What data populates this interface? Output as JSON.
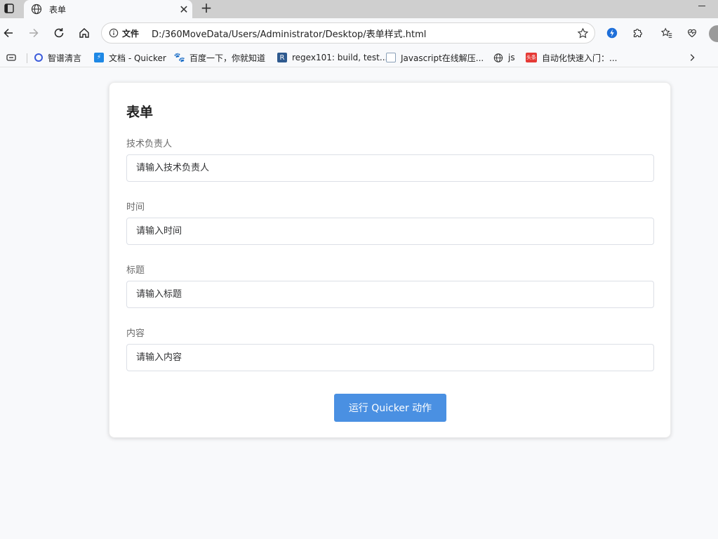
{
  "browser": {
    "tab": {
      "title": "表单"
    },
    "address": {
      "scheme": "文件",
      "url": "D:/360MoveData/Users/Administrator/Desktop/表单样式.html"
    },
    "bookmarks": [
      {
        "label": "智谱清言",
        "icon": "zhipu-icon",
        "color": "#3b5bdb"
      },
      {
        "label": "文档 - Quicker",
        "icon": "quicker-icon",
        "color": "#1e88e5"
      },
      {
        "label": "百度一下，你就知道",
        "icon": "baidu-paw-icon",
        "color": "#2932e1"
      },
      {
        "label": "regex101: build, test...",
        "icon": "regex101-icon",
        "color": "#2f5a8f"
      },
      {
        "label": "Javascript在线解压...",
        "icon": "document-icon",
        "color": "#8aa0b8"
      },
      {
        "label": "js",
        "icon": "globe-icon",
        "color": "#333333"
      },
      {
        "label": "自动化快速入门：...",
        "icon": "toutiao-icon",
        "color": "#e53935"
      }
    ]
  },
  "form": {
    "title": "表单",
    "fields": [
      {
        "label": "技术负责人",
        "placeholder": "请输入技术负责人"
      },
      {
        "label": "时间",
        "placeholder": "请输入时间"
      },
      {
        "label": "标题",
        "placeholder": "请输入标题"
      },
      {
        "label": "内容",
        "placeholder": "请输入内容"
      }
    ],
    "submit_label": "运行 Quicker 动作"
  },
  "colors": {
    "accent": "#4a90e2",
    "page_bg": "#f8f9fb",
    "tabstrip": "#cfcfcf"
  }
}
